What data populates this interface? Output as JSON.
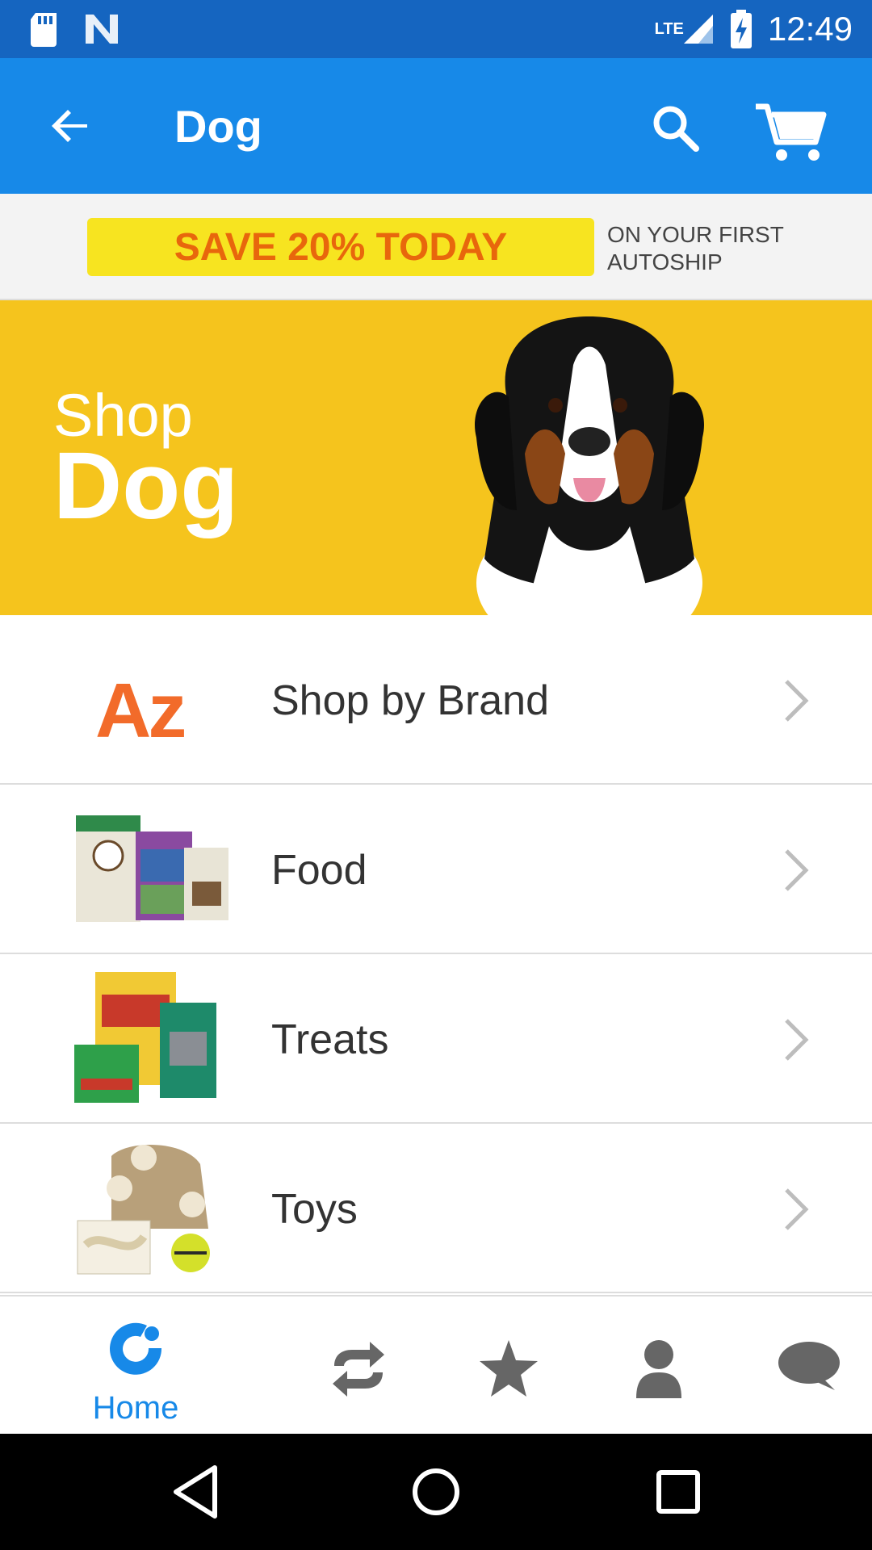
{
  "status_bar": {
    "time": "12:49",
    "network": "LTE"
  },
  "app_bar": {
    "title": "Dog",
    "icons": [
      "back-arrow-icon",
      "search-icon",
      "cart-icon"
    ]
  },
  "promo": {
    "headline": "SAVE 20% TODAY",
    "sub_line1": "ON YOUR FIRST",
    "sub_line2": "AUTOSHIP",
    "highlight_color": "#f7e420",
    "headline_color": "#e8670c"
  },
  "hero": {
    "line1": "Shop",
    "line2": "Dog",
    "background": "#f5c41d"
  },
  "az_logo": "Az",
  "categories": [
    {
      "label": "Shop by Brand"
    },
    {
      "label": "Food"
    },
    {
      "label": "Treats"
    },
    {
      "label": "Toys"
    }
  ],
  "bottom_nav": {
    "home_label": "Home",
    "active_color": "#1789e8",
    "icons": [
      "home-icon",
      "autoship-icon",
      "favorites-icon",
      "account-icon",
      "chat-icon"
    ]
  },
  "colors": {
    "status_bar": "#1565c0",
    "app_bar": "#1789e8"
  }
}
